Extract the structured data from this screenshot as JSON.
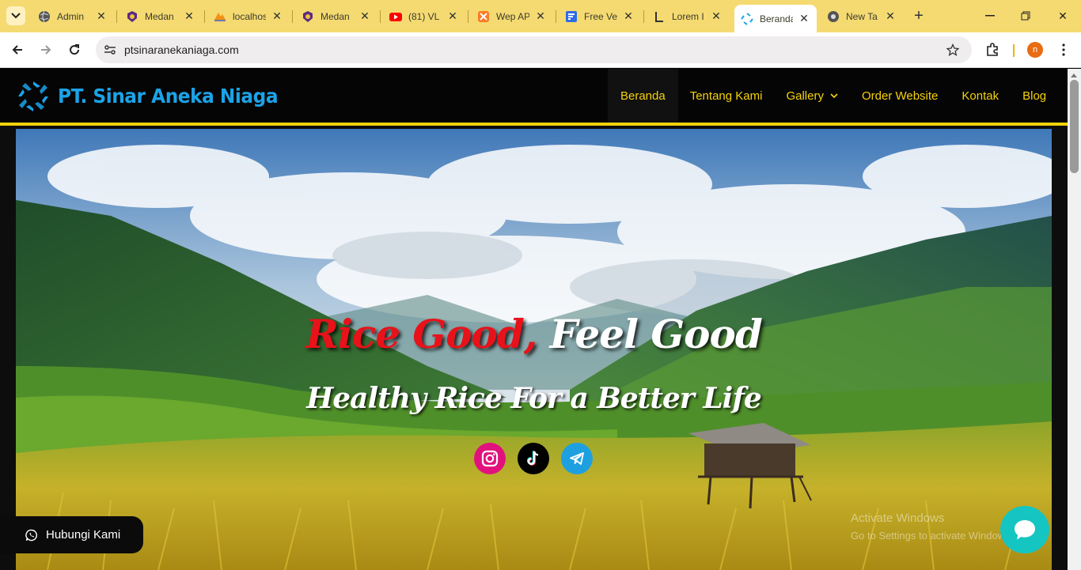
{
  "browser": {
    "tabs": [
      {
        "title": "Admin",
        "icon": "globe-icon"
      },
      {
        "title": "Medan",
        "icon": "medan-logo-icon"
      },
      {
        "title": "localhost",
        "icon": "phpmyadmin-icon"
      },
      {
        "title": "Medan",
        "icon": "medan-logo-icon"
      },
      {
        "title": "(81) VL",
        "icon": "youtube-icon"
      },
      {
        "title": "Wep AP",
        "icon": "xampp-icon"
      },
      {
        "title": "Free Ve",
        "icon": "forms-icon"
      },
      {
        "title": "Lorem I",
        "icon": "lorem-icon"
      },
      {
        "title": "Beranda",
        "icon": "site-logo-icon",
        "active": true
      },
      {
        "title": "New Ta",
        "icon": "chrome-icon"
      }
    ],
    "url": "ptsinaranekaniaga.com",
    "profile_initial": "n",
    "colors": {
      "tabstrip": "#f5da72",
      "profile": "#e96b12"
    }
  },
  "site": {
    "brand": "PT. Sinar Aneka Niaga",
    "menu": [
      {
        "label": "Beranda",
        "active": true
      },
      {
        "label": "Tentang Kami"
      },
      {
        "label": "Gallery",
        "dropdown": true
      },
      {
        "label": "Order Website"
      },
      {
        "label": "Kontak"
      },
      {
        "label": "Blog"
      }
    ],
    "hero": {
      "headline_red": "Rice Good,",
      "headline_white": "Feel Good",
      "subheadline": "Healthy Rice For a Better Life",
      "socials": [
        "instagram-icon",
        "tiktok-icon",
        "telegram-icon"
      ]
    },
    "contact_button": "Hubungi Kami",
    "windows_watermark": {
      "line1": "Activate Windows",
      "line2": "Go to Settings to activate Windows."
    },
    "colors": {
      "accent": "#f5d20c",
      "brand": "#1ba3e8",
      "headline_red": "#e8121a",
      "chat": "#15c5c2"
    }
  }
}
